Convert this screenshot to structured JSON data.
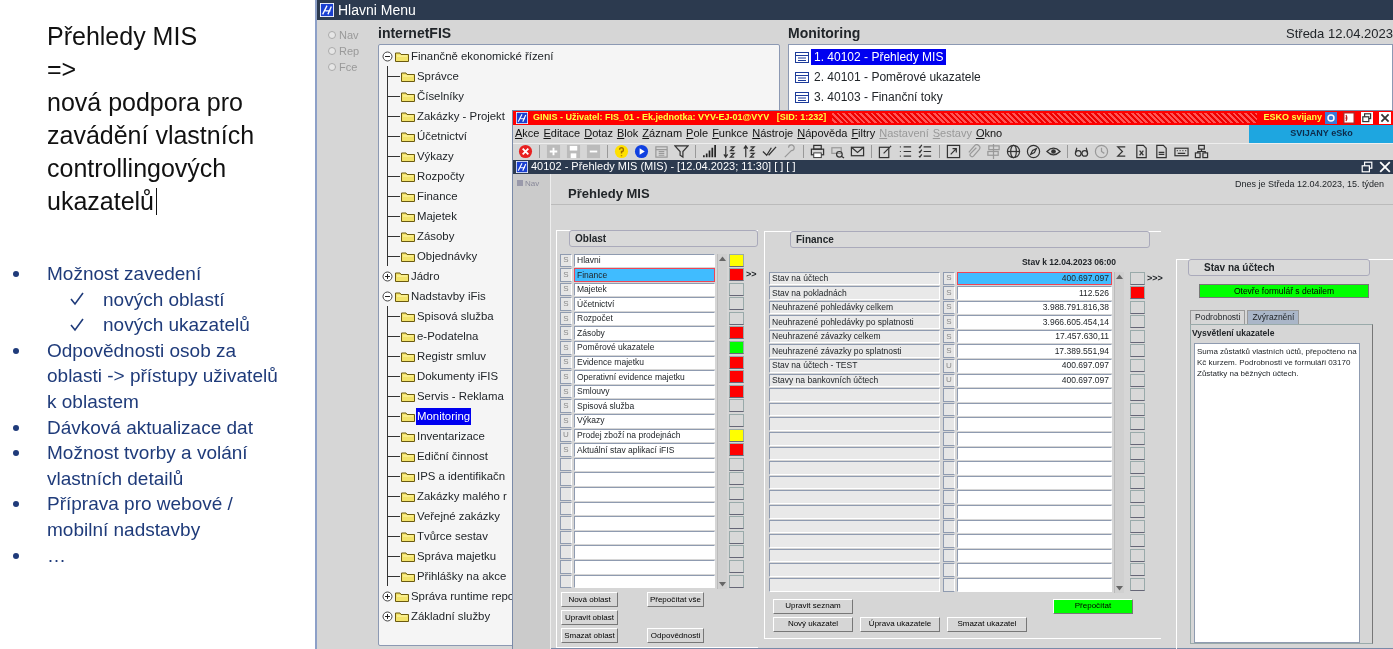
{
  "slide": {
    "title_lines": [
      "Přehledy MIS",
      "=>",
      "nová podpora pro zavádění vlastních controllingových ukazatelů"
    ],
    "bullets": [
      {
        "text": "Možnost zavedení",
        "children": [
          {
            "text": "nových oblastí"
          },
          {
            "text": "nových ukazatelů"
          }
        ]
      },
      {
        "text": "Odpovědnosti osob za oblasti -> přístupy uživatelů k oblastem"
      },
      {
        "text": "Dávková aktualizace dat"
      },
      {
        "text": "Možnost tvorby a volání vlastních detailů"
      },
      {
        "text": "Příprava pro webové / mobilní nadstavby"
      },
      {
        "text": "…"
      }
    ]
  },
  "main_window": {
    "title": "Hlavni Menu",
    "view_options": [
      {
        "label": "Nav",
        "selected": false,
        "disabled": true
      },
      {
        "label": "Rep",
        "selected": false,
        "disabled": true
      },
      {
        "label": "Fce",
        "selected": false,
        "disabled": true
      }
    ],
    "heading": "internetFIS",
    "tree": [
      {
        "label": "Finančně ekonomické řízení",
        "expanded": true,
        "selected": false,
        "children": [
          {
            "label": "Správce",
            "selected": false
          },
          {
            "label": "Číselníky",
            "selected": false
          },
          {
            "label": "Zakázky - Projekt",
            "selected": false
          },
          {
            "label": "Účetnictví",
            "selected": false
          },
          {
            "label": "Výkazy",
            "selected": false
          },
          {
            "label": "Rozpočty",
            "selected": false
          },
          {
            "label": "Finance",
            "selected": false
          },
          {
            "label": "Majetek",
            "selected": false
          },
          {
            "label": "Zásoby",
            "selected": false
          },
          {
            "label": "Objednávky",
            "selected": false
          }
        ]
      },
      {
        "label": "Jádro",
        "expanded": false,
        "selected": false
      },
      {
        "label": "Nadstavby iFis",
        "expanded": true,
        "selected": false,
        "children": [
          {
            "label": "Spisová služba",
            "selected": false
          },
          {
            "label": "e-Podatelna",
            "selected": false
          },
          {
            "label": "Registr smluv",
            "selected": false
          },
          {
            "label": "Dokumenty iFIS",
            "selected": false
          },
          {
            "label": "Servis - Reklama",
            "selected": false
          },
          {
            "label": "Monitoring",
            "selected": true
          },
          {
            "label": "Inventarizace",
            "selected": false
          },
          {
            "label": "Ediční činnost",
            "selected": false
          },
          {
            "label": "IPS a identifikačn",
            "selected": false
          },
          {
            "label": "Zakázky malého r",
            "selected": false
          },
          {
            "label": "Veřejné zakázky",
            "selected": false
          },
          {
            "label": "Tvůrce sestav",
            "selected": false
          },
          {
            "label": "Správa majetku",
            "selected": false
          },
          {
            "label": "Přihlášky na akce",
            "selected": false
          }
        ]
      },
      {
        "label": "Správa runtime repo",
        "expanded": false,
        "selected": false
      },
      {
        "label": "Základní služby",
        "expanded": false,
        "selected": false
      }
    ],
    "monitoring": {
      "heading": "Monitoring",
      "date": "Středa  12.04.2023",
      "items": [
        {
          "label": "1. 40102 - Přehledy MIS",
          "selected": true
        },
        {
          "label": "2. 40101 - Poměrové ukazatele",
          "selected": false
        },
        {
          "label": "3. 40103 - Finanční toky",
          "selected": false
        }
      ]
    }
  },
  "ginis_window": {
    "title": "GINIS - Uživatel: FIS_01 - Ek.jednotka: VYV-EJ-01@VYV   [SID: 1:232]",
    "org": "ESKO svijany",
    "menu": [
      {
        "label": "Akce",
        "disabled": false
      },
      {
        "label": "Editace",
        "disabled": false
      },
      {
        "label": "Dotaz",
        "disabled": false
      },
      {
        "label": "Blok",
        "disabled": false
      },
      {
        "label": "Záznam",
        "disabled": false
      },
      {
        "label": "Pole",
        "disabled": false
      },
      {
        "label": "Funkce",
        "disabled": false
      },
      {
        "label": "Nástroje",
        "disabled": false
      },
      {
        "label": "Nápověda",
        "disabled": false
      },
      {
        "label": "Filtry",
        "disabled": false
      },
      {
        "label": "Nastavení",
        "disabled": true
      },
      {
        "label": "Sestavy",
        "disabled": true
      },
      {
        "label": "Okno",
        "disabled": false
      }
    ],
    "org_badge": "SVIJANY eSko",
    "form_title": "40102 - Přehledy MIS (MIS) - [12.04.2023; 11:30] [ ] [ ]",
    "nav_label": "Nav",
    "heading": "Přehledy MIS",
    "today": "Dnes je Středa  12.04.2023, 15. týden",
    "oblast": {
      "title": "Oblast",
      "pointer": ">>",
      "rows": [
        {
          "type": "S",
          "name": "Hlavni",
          "selected": false,
          "color": "#ffff00"
        },
        {
          "type": "S",
          "name": "Finance",
          "selected": true,
          "color": "#ff0000"
        },
        {
          "type": "S",
          "name": "Majetek",
          "selected": false
        },
        {
          "type": "S",
          "name": "Účetnictví",
          "selected": false
        },
        {
          "type": "S",
          "name": "Rozpočet",
          "selected": false
        },
        {
          "type": "S",
          "name": "Zásoby",
          "selected": false,
          "color": "#ff0000"
        },
        {
          "type": "S",
          "name": "Poměrové ukazatele",
          "selected": false,
          "color": "#00ff00"
        },
        {
          "type": "S",
          "name": "Evidence majetku",
          "selected": false,
          "color": "#ff0000"
        },
        {
          "type": "S",
          "name": "Operativní evidence majetku",
          "selected": false,
          "color": "#ff0000"
        },
        {
          "type": "S",
          "name": "Smlouvy",
          "selected": false,
          "color": "#ff0000"
        },
        {
          "type": "S",
          "name": "Spisová služba",
          "selected": false
        },
        {
          "type": "S",
          "name": "Výkazy",
          "selected": false
        },
        {
          "type": "U",
          "name": "Prodej zboží na prodejnách",
          "selected": false,
          "color": "#ffff00"
        },
        {
          "type": "S",
          "name": "Aktuální stav aplikací iFIS",
          "selected": false,
          "color": "#ff0000"
        }
      ],
      "button_rows": [
        [
          {
            "label": "Nová oblast",
            "kind": "plain"
          },
          {
            "label": "Přepočítat vše",
            "kind": "plain"
          }
        ],
        [
          {
            "label": "Upravit oblast",
            "kind": "plain"
          }
        ],
        [
          {
            "label": "Smazat oblast",
            "kind": "plain"
          },
          {
            "label": "Odpovědnosti",
            "kind": "plain"
          }
        ]
      ]
    },
    "finance": {
      "title": "Finance",
      "as_of": "Stav k 12.04.2023 06:00",
      "pointer": ">>>",
      "rows": [
        {
          "name": "Stav na účtech",
          "type": "S",
          "value": "400.697.097",
          "selected": true
        },
        {
          "name": "Stav na pokladnách",
          "type": "S",
          "value": "112.526",
          "selected": false,
          "color": "#ff0000"
        },
        {
          "name": "Neuhrazené pohledávky celkem",
          "type": "S",
          "value": "3.988.791.816,38",
          "selected": false
        },
        {
          "name": "Neuhrazené pohledávky po splatnosti",
          "type": "S",
          "value": "3.966.605.454,14",
          "selected": false
        },
        {
          "name": "Neuhrazené závazky celkem",
          "type": "S",
          "value": "17.457.630,11",
          "selected": false
        },
        {
          "name": "Neuhrazené závazky po splatnosti",
          "type": "S",
          "value": "17.389.551,94",
          "selected": false
        },
        {
          "name": "Stav na účtech - TEST",
          "type": "U",
          "value": "400.697.097",
          "selected": false
        },
        {
          "name": "Stavy na bankovních účtech",
          "type": "U",
          "value": "400.697.097",
          "selected": false
        }
      ],
      "button_rows": [
        [
          {
            "label": "Upravit seznam",
            "kind": "plain"
          },
          {
            "label": "Přepočítat",
            "kind": "green"
          }
        ],
        [
          {
            "label": "Nový ukazatel",
            "kind": "plain"
          },
          {
            "label": "Úprava ukazatele",
            "kind": "plain"
          },
          {
            "label": "Smazat ukazatel",
            "kind": "plain"
          }
        ]
      ]
    },
    "detail": {
      "title": "Stav na účtech",
      "open_button": "Otevře formulář s detailem",
      "tabs": [
        {
          "label": "Podrobnosti",
          "selected": true
        },
        {
          "label": "Zvýraznění",
          "selected": false
        }
      ],
      "label": "Vysvětlení ukazatele",
      "text": "Suma zůstatků vlastních účtů, přepočteno na Kč kurzem. Podrobnosti ve formuláři 03170 Zůstatky na běžných účtech."
    }
  }
}
